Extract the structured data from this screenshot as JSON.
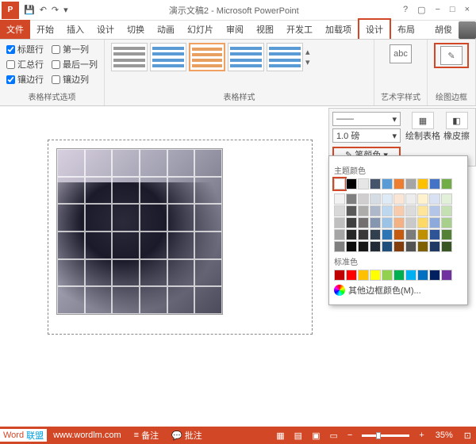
{
  "title": "演示文稿2 - Microsoft PowerPoint",
  "username": "胡俊",
  "tabs": {
    "file": "文件",
    "items": [
      "开始",
      "插入",
      "设计",
      "切换",
      "动画",
      "幻灯片",
      "审阅",
      "视图",
      "开发工",
      "加载项",
      "设计",
      "布局"
    ]
  },
  "active_tab_idx": 10,
  "table_options": {
    "label": "表格样式选项",
    "checks": [
      {
        "label": "标题行",
        "checked": true
      },
      {
        "label": "汇总行",
        "checked": false
      },
      {
        "label": "镶边行",
        "checked": true
      },
      {
        "label": "第一列",
        "checked": false
      },
      {
        "label": "最后一列",
        "checked": false
      },
      {
        "label": "镶边列",
        "checked": false
      }
    ]
  },
  "table_styles": {
    "label": "表格样式"
  },
  "art_text": "艺术字样式",
  "draw_border": "绘图边框",
  "pen_style": "——",
  "pen_weight": "1.0 磅",
  "pen_color_label": "笔颜色",
  "draw_table": "绘制表格",
  "eraser": "橡皮擦",
  "popup": {
    "theme": "主题颜色",
    "standard": "标准色",
    "more": "其他边框颜色(M)..."
  },
  "theme_row1": [
    "#ffffff",
    "#000000",
    "#e7e6e6",
    "#44546a",
    "#5b9bd5",
    "#ed7d31",
    "#a5a5a5",
    "#ffc000",
    "#4472c4",
    "#70ad47"
  ],
  "theme_shades": [
    [
      "#f2f2f2",
      "#7f7f7f",
      "#d0cece",
      "#d6dce4",
      "#deebf6",
      "#fbe5d5",
      "#ededed",
      "#fff2cc",
      "#d9e2f3",
      "#e2efd9"
    ],
    [
      "#d8d8d8",
      "#595959",
      "#aeabab",
      "#adb9ca",
      "#bdd7ee",
      "#f7cbac",
      "#dbdbdb",
      "#fee599",
      "#b4c6e7",
      "#c5e0b3"
    ],
    [
      "#bfbfbf",
      "#3f3f3f",
      "#757070",
      "#8496b0",
      "#9cc3e5",
      "#f4b183",
      "#c9c9c9",
      "#ffd965",
      "#8eaadb",
      "#a8d08d"
    ],
    [
      "#a5a5a5",
      "#262626",
      "#3a3838",
      "#323f4f",
      "#2e75b5",
      "#c55a11",
      "#7b7b7b",
      "#bf9000",
      "#2f5496",
      "#538135"
    ],
    [
      "#7f7f7f",
      "#0c0c0c",
      "#171616",
      "#222a35",
      "#1e4e79",
      "#833c0b",
      "#525252",
      "#7f6000",
      "#1f3864",
      "#375623"
    ]
  ],
  "standard_colors": [
    "#c00000",
    "#ff0000",
    "#ffc000",
    "#ffff00",
    "#92d050",
    "#00b050",
    "#00b0f0",
    "#0070c0",
    "#002060",
    "#7030a0"
  ],
  "statusbar": {
    "watermark_word": "Word",
    "watermark_lm": "联盟",
    "url": "www.wordlm.com",
    "notes": "备注",
    "comments": "批注",
    "zoom": "35%"
  }
}
